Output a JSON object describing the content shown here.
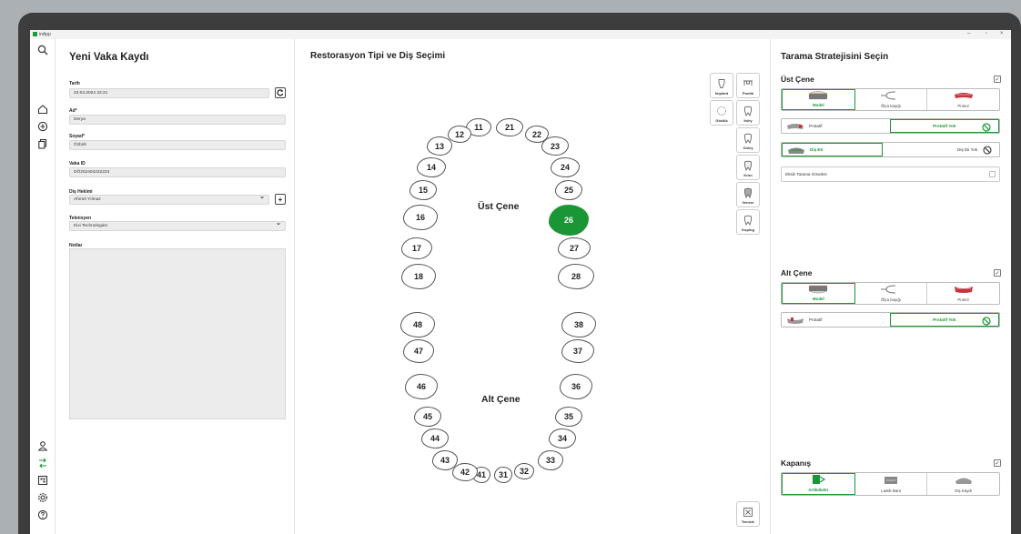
{
  "app": {
    "title": "inApp",
    "controls": [
      "–",
      "▫",
      "×"
    ]
  },
  "rail": {
    "top": [
      "search-icon"
    ],
    "middle": [
      "home-icon",
      "plus-circle-icon",
      "copy-icon"
    ],
    "bottom": [
      "user-icon",
      "route-icon",
      "grid-icon",
      "settings-icon",
      "help-icon"
    ]
  },
  "left": {
    "title": "Yeni Vaka Kaydı",
    "date_label": "Tarih",
    "date_value": "23.04.2024 22:21",
    "name_label": "Ad*",
    "name_value": "Derya",
    "surname_label": "Soyad*",
    "surname_value": "Özbirk",
    "case_id_label": "Vaka ID",
    "case_id_value": "DÖ202404232223",
    "dentist_label": "Diş Hekimi",
    "dentist_value": "Ahmet Yılmaz",
    "tech_label": "Teknisyen",
    "tech_value": "Kivi Technologies",
    "notes_label": "Notlar"
  },
  "middle": {
    "title": "Restorasyon Tipi ve Diş Seçimi",
    "upper_jaw": "Üst Çene",
    "lower_jaw": "Alt Çene",
    "teeth": [
      "11",
      "12",
      "13",
      "14",
      "15",
      "16",
      "17",
      "18",
      "21",
      "22",
      "23",
      "24",
      "25",
      "26",
      "27",
      "28",
      "31",
      "32",
      "33",
      "34",
      "35",
      "36",
      "37",
      "38",
      "41",
      "42",
      "43",
      "44",
      "45",
      "46",
      "47",
      "48"
    ],
    "selected_tooth": "26",
    "restorations": [
      "İmplant",
      "Pontik",
      "Gözlük",
      "İnley",
      "Onley",
      "Kron",
      "Veneer",
      "Koping"
    ],
    "clear_label": "Temizle"
  },
  "right": {
    "title": "Tarama Stratejisini Seçin",
    "upper": {
      "label": "Üst Çene",
      "checked": true,
      "options": [
        "Model",
        "Ölçü kaşığı",
        "Protez"
      ],
      "selected": "Model",
      "prothesis": [
        "Protatif",
        "Protatif Yok"
      ],
      "prothesis_selected": "Protatif Yok",
      "gum": [
        "Diş Eti",
        "Diş Eti Yok"
      ],
      "gum_selected": "Diş Eti",
      "missing": "Eksik Tarama Gövdesi"
    },
    "lower": {
      "label": "Alt Çene",
      "checked": true,
      "options": [
        "Model",
        "Ölçü kaşığı",
        "Protez"
      ],
      "selected": "Model",
      "prothesis": [
        "Protatif",
        "Protatif Yok"
      ],
      "prothesis_selected": "Protatif Yok"
    },
    "bite": {
      "label": "Kapanış",
      "checked": true,
      "options": [
        "Artikülatör",
        "Lastik Bant",
        "Diş Kaydı"
      ],
      "selected": "Artikülatör"
    }
  },
  "colors": {
    "accent": "#1a9636",
    "frame": "#3d3d3d",
    "field": "#ececec"
  }
}
